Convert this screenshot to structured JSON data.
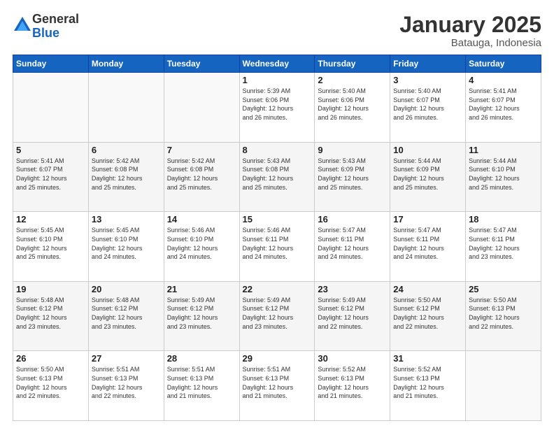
{
  "header": {
    "logo_general": "General",
    "logo_blue": "Blue",
    "month_title": "January 2025",
    "subtitle": "Batauga, Indonesia"
  },
  "days_of_week": [
    "Sunday",
    "Monday",
    "Tuesday",
    "Wednesday",
    "Thursday",
    "Friday",
    "Saturday"
  ],
  "weeks": [
    [
      {
        "day": "",
        "info": ""
      },
      {
        "day": "",
        "info": ""
      },
      {
        "day": "",
        "info": ""
      },
      {
        "day": "1",
        "info": "Sunrise: 5:39 AM\nSunset: 6:06 PM\nDaylight: 12 hours\nand 26 minutes."
      },
      {
        "day": "2",
        "info": "Sunrise: 5:40 AM\nSunset: 6:06 PM\nDaylight: 12 hours\nand 26 minutes."
      },
      {
        "day": "3",
        "info": "Sunrise: 5:40 AM\nSunset: 6:07 PM\nDaylight: 12 hours\nand 26 minutes."
      },
      {
        "day": "4",
        "info": "Sunrise: 5:41 AM\nSunset: 6:07 PM\nDaylight: 12 hours\nand 26 minutes."
      }
    ],
    [
      {
        "day": "5",
        "info": "Sunrise: 5:41 AM\nSunset: 6:07 PM\nDaylight: 12 hours\nand 25 minutes."
      },
      {
        "day": "6",
        "info": "Sunrise: 5:42 AM\nSunset: 6:08 PM\nDaylight: 12 hours\nand 25 minutes."
      },
      {
        "day": "7",
        "info": "Sunrise: 5:42 AM\nSunset: 6:08 PM\nDaylight: 12 hours\nand 25 minutes."
      },
      {
        "day": "8",
        "info": "Sunrise: 5:43 AM\nSunset: 6:08 PM\nDaylight: 12 hours\nand 25 minutes."
      },
      {
        "day": "9",
        "info": "Sunrise: 5:43 AM\nSunset: 6:09 PM\nDaylight: 12 hours\nand 25 minutes."
      },
      {
        "day": "10",
        "info": "Sunrise: 5:44 AM\nSunset: 6:09 PM\nDaylight: 12 hours\nand 25 minutes."
      },
      {
        "day": "11",
        "info": "Sunrise: 5:44 AM\nSunset: 6:10 PM\nDaylight: 12 hours\nand 25 minutes."
      }
    ],
    [
      {
        "day": "12",
        "info": "Sunrise: 5:45 AM\nSunset: 6:10 PM\nDaylight: 12 hours\nand 25 minutes."
      },
      {
        "day": "13",
        "info": "Sunrise: 5:45 AM\nSunset: 6:10 PM\nDaylight: 12 hours\nand 24 minutes."
      },
      {
        "day": "14",
        "info": "Sunrise: 5:46 AM\nSunset: 6:10 PM\nDaylight: 12 hours\nand 24 minutes."
      },
      {
        "day": "15",
        "info": "Sunrise: 5:46 AM\nSunset: 6:11 PM\nDaylight: 12 hours\nand 24 minutes."
      },
      {
        "day": "16",
        "info": "Sunrise: 5:47 AM\nSunset: 6:11 PM\nDaylight: 12 hours\nand 24 minutes."
      },
      {
        "day": "17",
        "info": "Sunrise: 5:47 AM\nSunset: 6:11 PM\nDaylight: 12 hours\nand 24 minutes."
      },
      {
        "day": "18",
        "info": "Sunrise: 5:47 AM\nSunset: 6:11 PM\nDaylight: 12 hours\nand 23 minutes."
      }
    ],
    [
      {
        "day": "19",
        "info": "Sunrise: 5:48 AM\nSunset: 6:12 PM\nDaylight: 12 hours\nand 23 minutes."
      },
      {
        "day": "20",
        "info": "Sunrise: 5:48 AM\nSunset: 6:12 PM\nDaylight: 12 hours\nand 23 minutes."
      },
      {
        "day": "21",
        "info": "Sunrise: 5:49 AM\nSunset: 6:12 PM\nDaylight: 12 hours\nand 23 minutes."
      },
      {
        "day": "22",
        "info": "Sunrise: 5:49 AM\nSunset: 6:12 PM\nDaylight: 12 hours\nand 23 minutes."
      },
      {
        "day": "23",
        "info": "Sunrise: 5:49 AM\nSunset: 6:12 PM\nDaylight: 12 hours\nand 22 minutes."
      },
      {
        "day": "24",
        "info": "Sunrise: 5:50 AM\nSunset: 6:12 PM\nDaylight: 12 hours\nand 22 minutes."
      },
      {
        "day": "25",
        "info": "Sunrise: 5:50 AM\nSunset: 6:13 PM\nDaylight: 12 hours\nand 22 minutes."
      }
    ],
    [
      {
        "day": "26",
        "info": "Sunrise: 5:50 AM\nSunset: 6:13 PM\nDaylight: 12 hours\nand 22 minutes."
      },
      {
        "day": "27",
        "info": "Sunrise: 5:51 AM\nSunset: 6:13 PM\nDaylight: 12 hours\nand 22 minutes."
      },
      {
        "day": "28",
        "info": "Sunrise: 5:51 AM\nSunset: 6:13 PM\nDaylight: 12 hours\nand 21 minutes."
      },
      {
        "day": "29",
        "info": "Sunrise: 5:51 AM\nSunset: 6:13 PM\nDaylight: 12 hours\nand 21 minutes."
      },
      {
        "day": "30",
        "info": "Sunrise: 5:52 AM\nSunset: 6:13 PM\nDaylight: 12 hours\nand 21 minutes."
      },
      {
        "day": "31",
        "info": "Sunrise: 5:52 AM\nSunset: 6:13 PM\nDaylight: 12 hours\nand 21 minutes."
      },
      {
        "day": "",
        "info": ""
      }
    ]
  ]
}
